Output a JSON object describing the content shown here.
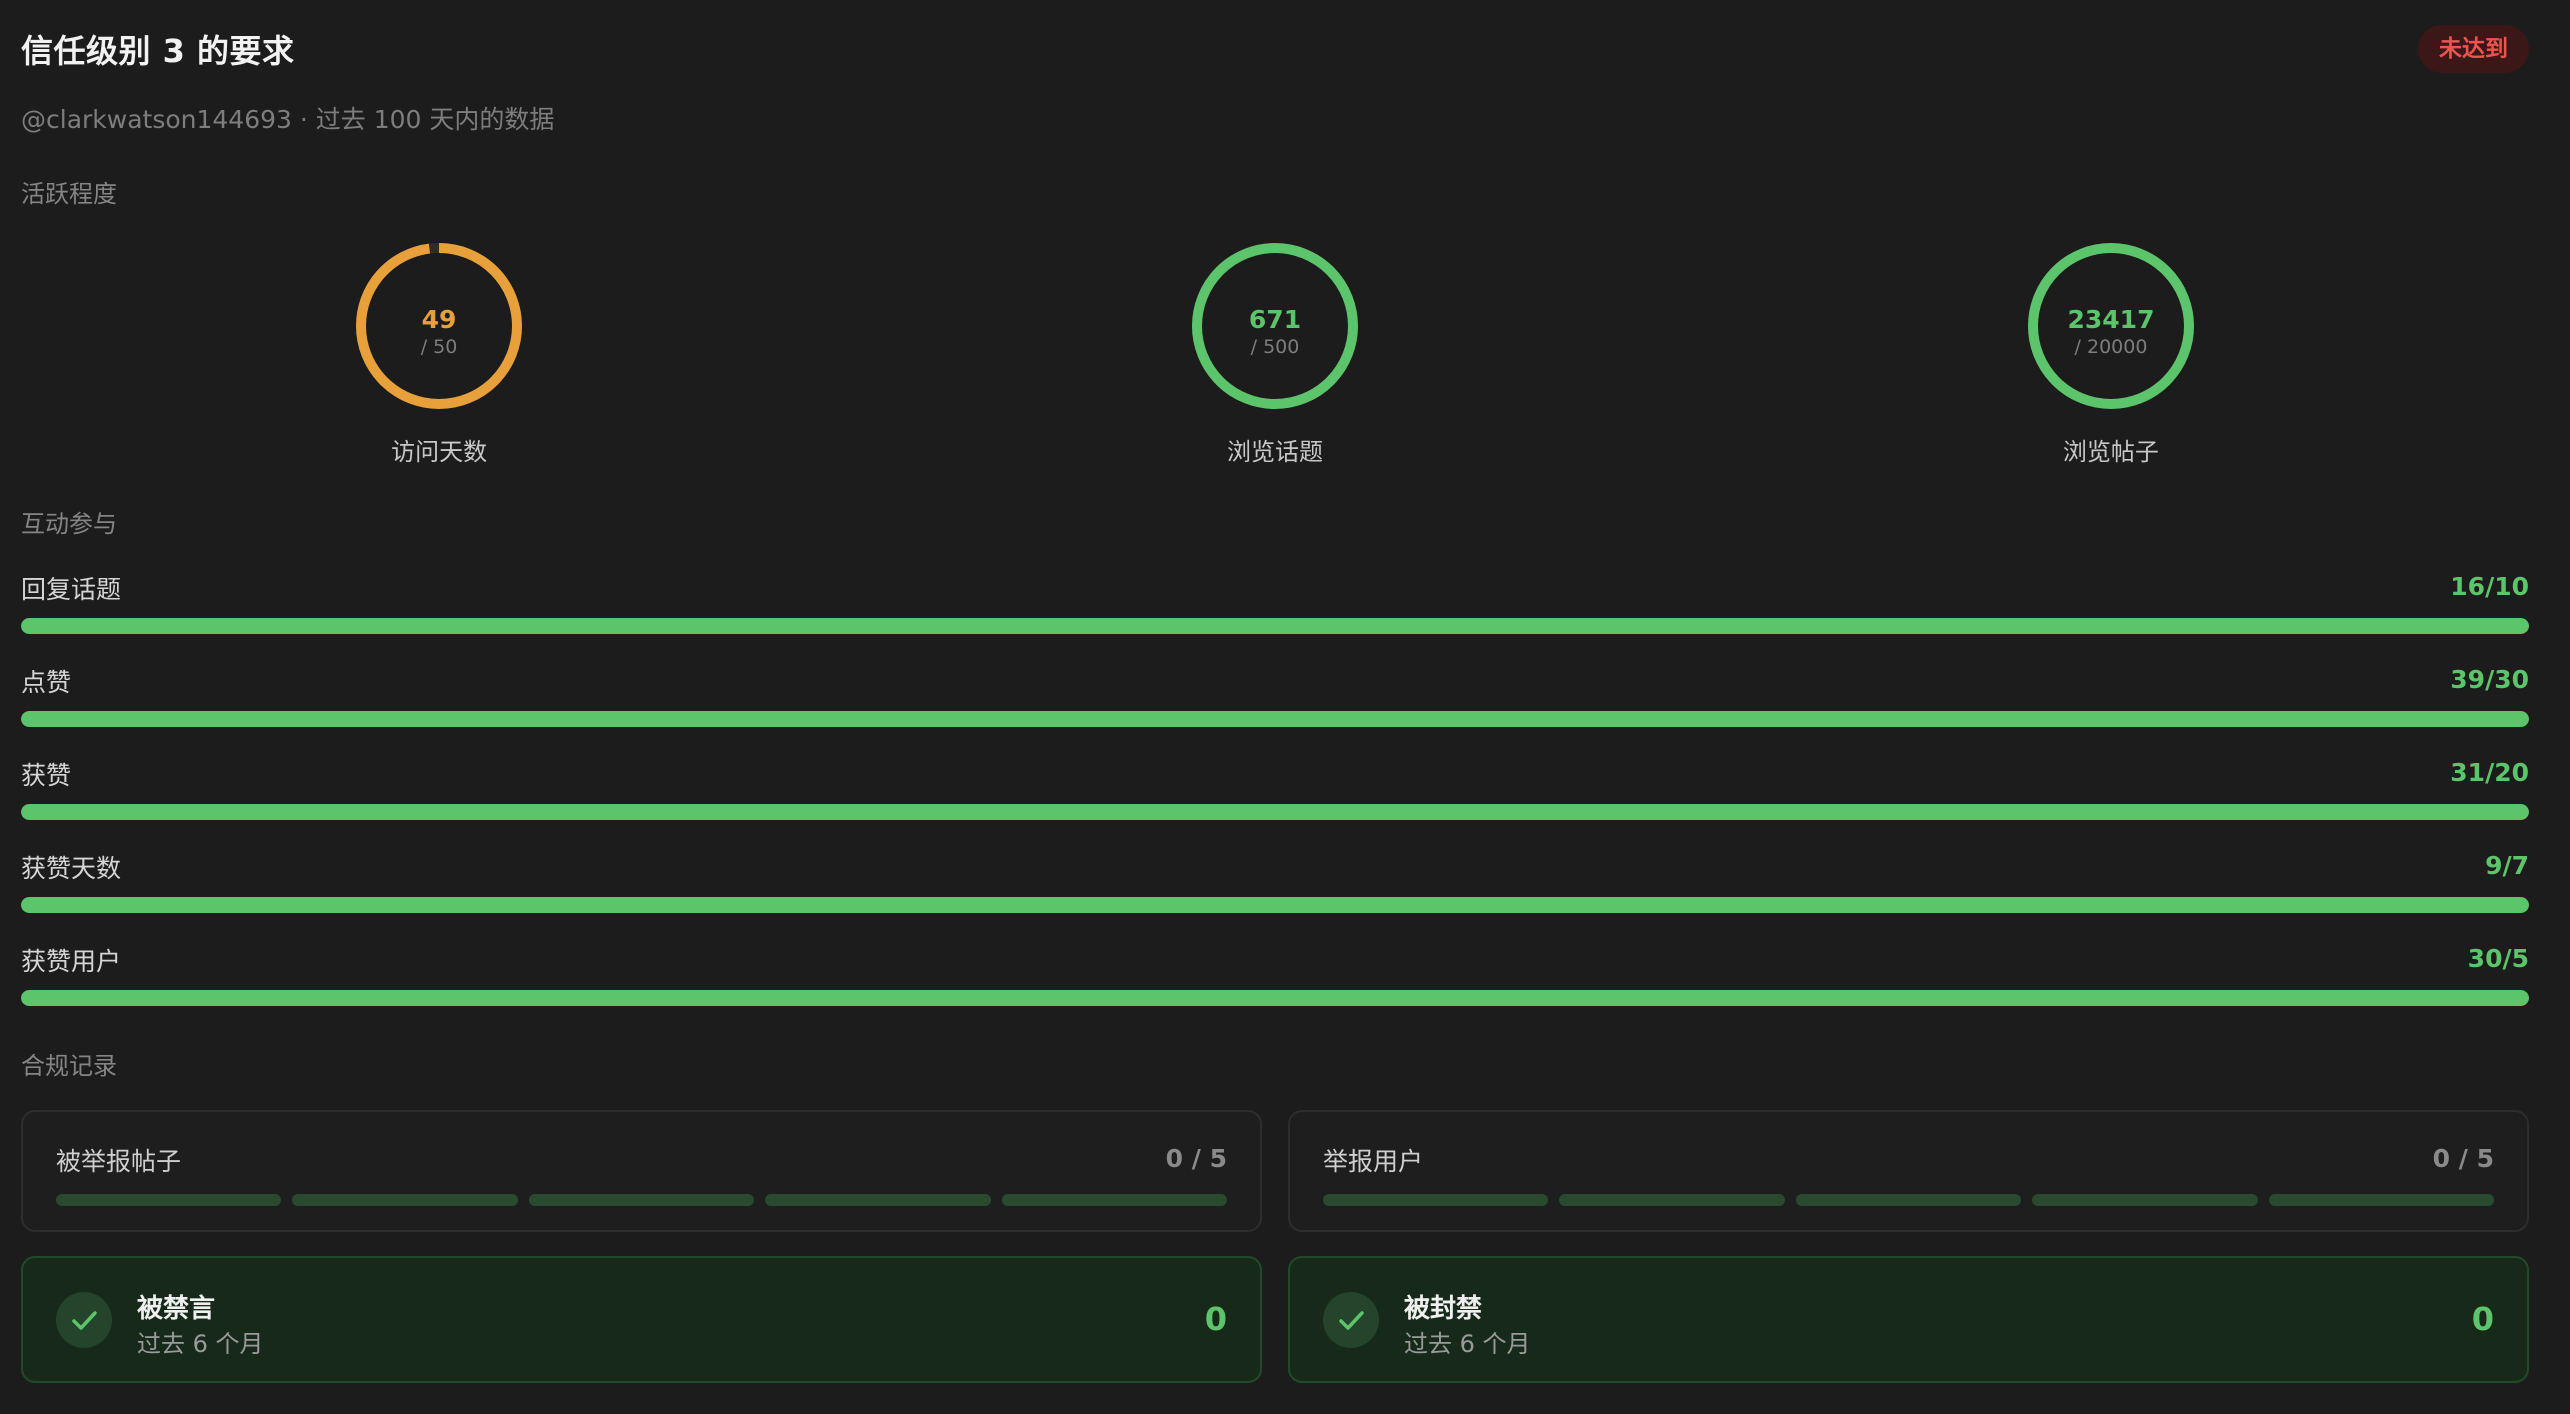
{
  "header": {
    "title": "信任级别 3 的要求",
    "status_badge": "未达到",
    "subtitle": "@clarkwatson144693 · 过去 100 天内的数据"
  },
  "colors": {
    "success": "#5cc46a",
    "warning": "#e8a13a",
    "danger": "#ef5350",
    "background": "#1c1c1c"
  },
  "activity": {
    "section_title": "活跃程度",
    "rings": [
      {
        "label": "访问天数",
        "value": "49",
        "target": "/ 50",
        "progress": 0.98,
        "status": "warning"
      },
      {
        "label": "浏览话题",
        "value": "671",
        "target": "/ 500",
        "progress": 1.0,
        "status": "success"
      },
      {
        "label": "浏览帖子",
        "value": "23417",
        "target": "/ 20000",
        "progress": 1.0,
        "status": "success"
      }
    ]
  },
  "interaction": {
    "section_title": "互动参与",
    "items": [
      {
        "label": "回复话题",
        "value": "16/10",
        "progress": 1.0
      },
      {
        "label": "点赞",
        "value": "39/30",
        "progress": 1.0
      },
      {
        "label": "获赞",
        "value": "31/20",
        "progress": 1.0
      },
      {
        "label": "获赞天数",
        "value": "9/7",
        "progress": 1.0
      },
      {
        "label": "获赞用户",
        "value": "30/5",
        "progress": 1.0
      }
    ]
  },
  "compliance": {
    "section_title": "合规记录",
    "reports": [
      {
        "title": "被举报帖子",
        "count": "0 / 5",
        "filled": 0,
        "total": 5
      },
      {
        "title": "举报用户",
        "count": "0 / 5",
        "filled": 0,
        "total": 5
      }
    ],
    "statuses": [
      {
        "title": "被禁言",
        "subtitle": "过去 6 个月",
        "count": "0",
        "icon": "check-icon"
      },
      {
        "title": "被封禁",
        "subtitle": "过去 6 个月",
        "count": "0",
        "icon": "check-icon"
      }
    ]
  }
}
